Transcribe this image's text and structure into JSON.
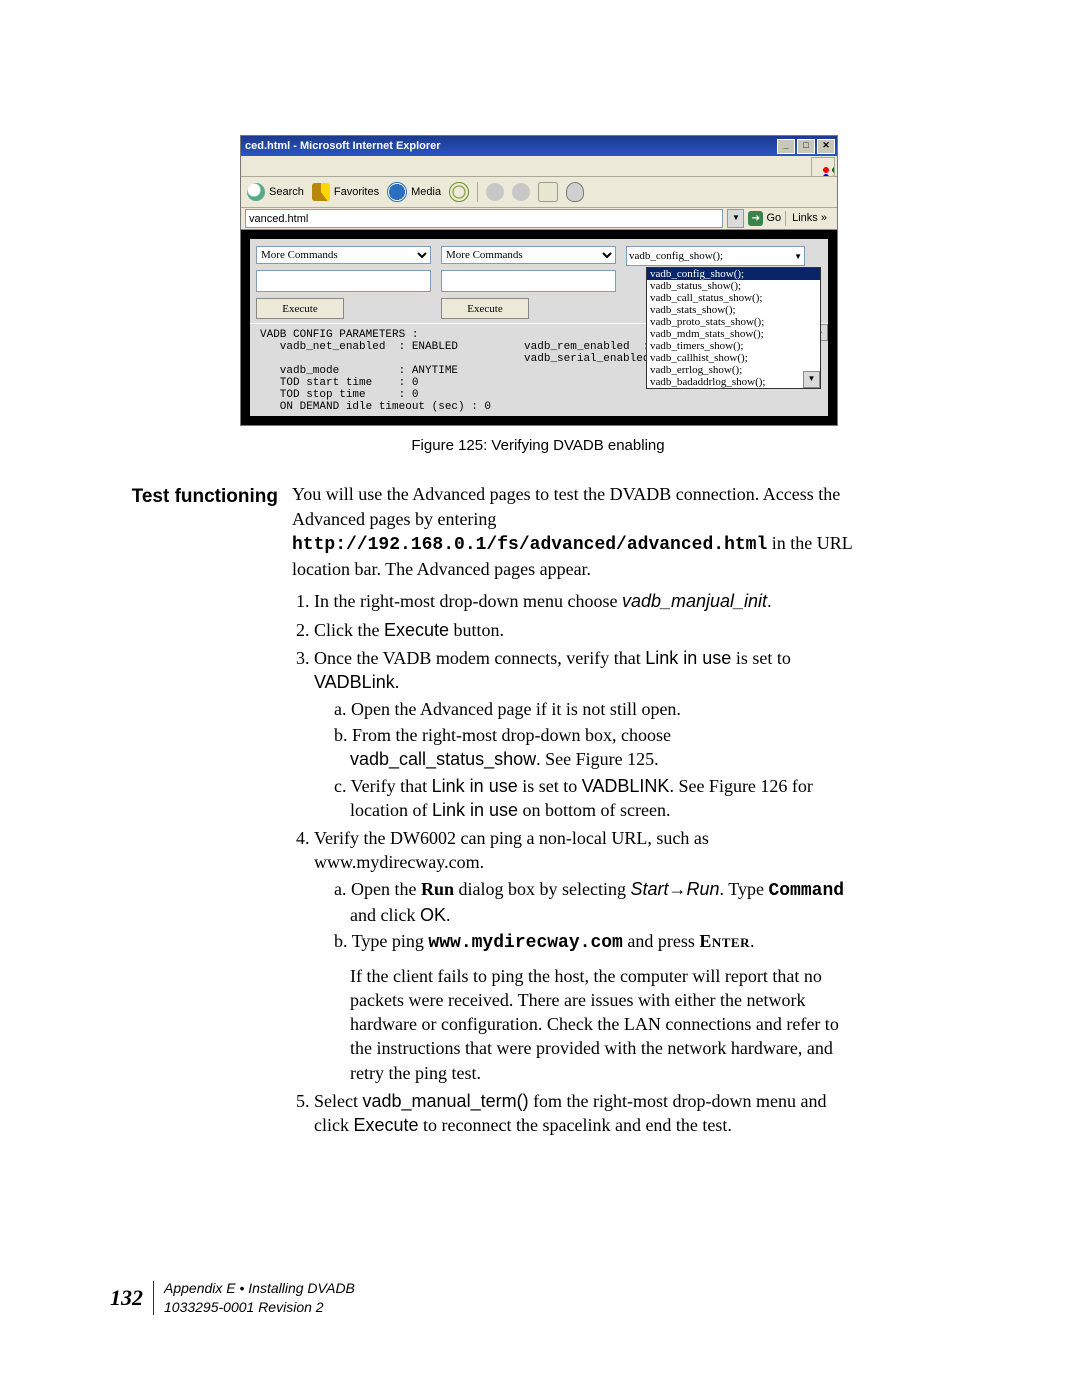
{
  "screenshot": {
    "titlebar_fragment": "ced.html - Microsoft Internet Explorer",
    "win_min": "_",
    "win_max": "□",
    "win_close": "✕",
    "toolbar": {
      "search": "Search",
      "favorites": "Favorites",
      "media": "Media"
    },
    "address_value": "vanced.html",
    "go": "Go",
    "links": "Links",
    "links_chevron": "»",
    "panel": {
      "select_left": "More Commands",
      "select_mid": "More Commands",
      "select_right_current": "vadb_config_show();",
      "execute": "Execute",
      "dropdown_items": [
        "vadb_config_show();",
        "vadb_status_show();",
        "vadb_call_status_show();",
        "vadb_stats_show();",
        "vadb_proto_stats_show();",
        "vadb_mdm_stats_show();",
        "vadb_timers_show();",
        "vadb_callhist_show();",
        "vadb_errlog_show();",
        "vadb_badaddrlog_show();"
      ],
      "dropdown_selected_index": 0
    },
    "output": "VADB CONFIG PARAMETERS :\n   vadb_net_enabled  : ENABLED          vadb_rem_enabled  : ENABLED\n                                        vadb_serial_enabled:ENABLED\n   vadb_mode         : ANYTIME\n   TOD start time    : 0\n   TOD stop time     : 0\n   ON DEMAND idle timeout (sec) : 0"
  },
  "figcaption": "Figure 125:  Verifying DVADB enabling",
  "section_title": "Test functioning",
  "intro": {
    "line1a": "You will use the Advanced pages to test the DVADB connection. Access the Advanced pages by entering",
    "url": "http://192.168.0.1/fs/advanced/advanced.html",
    "line1b": " in the URL location bar. The Advanced pages appear."
  },
  "step1": {
    "pre": "In the right-most drop-down menu choose ",
    "cmd": "vadb_manjual_init",
    "post": "."
  },
  "step2": {
    "pre": "Click the ",
    "btn": "Execute",
    "post": " button."
  },
  "step3": {
    "pre": "Once the VADB modem connects, verify that ",
    "liu": "Link in use",
    "mid": " is set to ",
    "val": "VADBLink",
    "post": ".",
    "a": "Open the Advanced page if it is not still open.",
    "b_pre": "From the right-most drop-down box, choose ",
    "b_cmd": "vadb_call_status_show",
    "b_post": ". See Figure 125.",
    "c_pre": "Verify that ",
    "c_liu": "Link in use",
    "c_mid": " is set to ",
    "c_val": "VADBLINK",
    "c_post1": ". See Figure 126 for location of ",
    "c_liu2": "Link in use",
    "c_post2": " on bottom of screen."
  },
  "step4": {
    "line": "Verify the DW6002 can ping a non-local URL, such as www.mydirecway.com.",
    "a_pre": "Open the ",
    "a_run": "Run",
    "a_mid1": " dialog box by selecting ",
    "a_start": "Start",
    "a_arrow": "→",
    "a_runit": "Run",
    "a_mid2": ". Type ",
    "a_cmd": "Command",
    "a_mid3": " and click ",
    "a_ok": "OK",
    "a_post": ".",
    "b_pre": "Type ping ",
    "b_host": "www.mydirecway.com",
    "b_mid": " and press ",
    "b_enter": "Enter",
    "b_post": ".",
    "b_para": "If the client fails to ping the host, the computer will report that no packets were received.  There are issues with either the network hardware or configuration.  Check the LAN connections and refer to the instructions that were provided with the network hardware, and retry the ping test."
  },
  "step5": {
    "pre": "Select ",
    "cmd": "vadb_manual_term()",
    "mid": " fom the right-most drop-down menu and click ",
    "exe": "Execute",
    "post": " to reconnect the spacelink and end the test."
  },
  "footer": {
    "page": "132",
    "appendix": "Appendix E • Installing DVADB",
    "docid": "1033295-0001  Revision 2"
  }
}
